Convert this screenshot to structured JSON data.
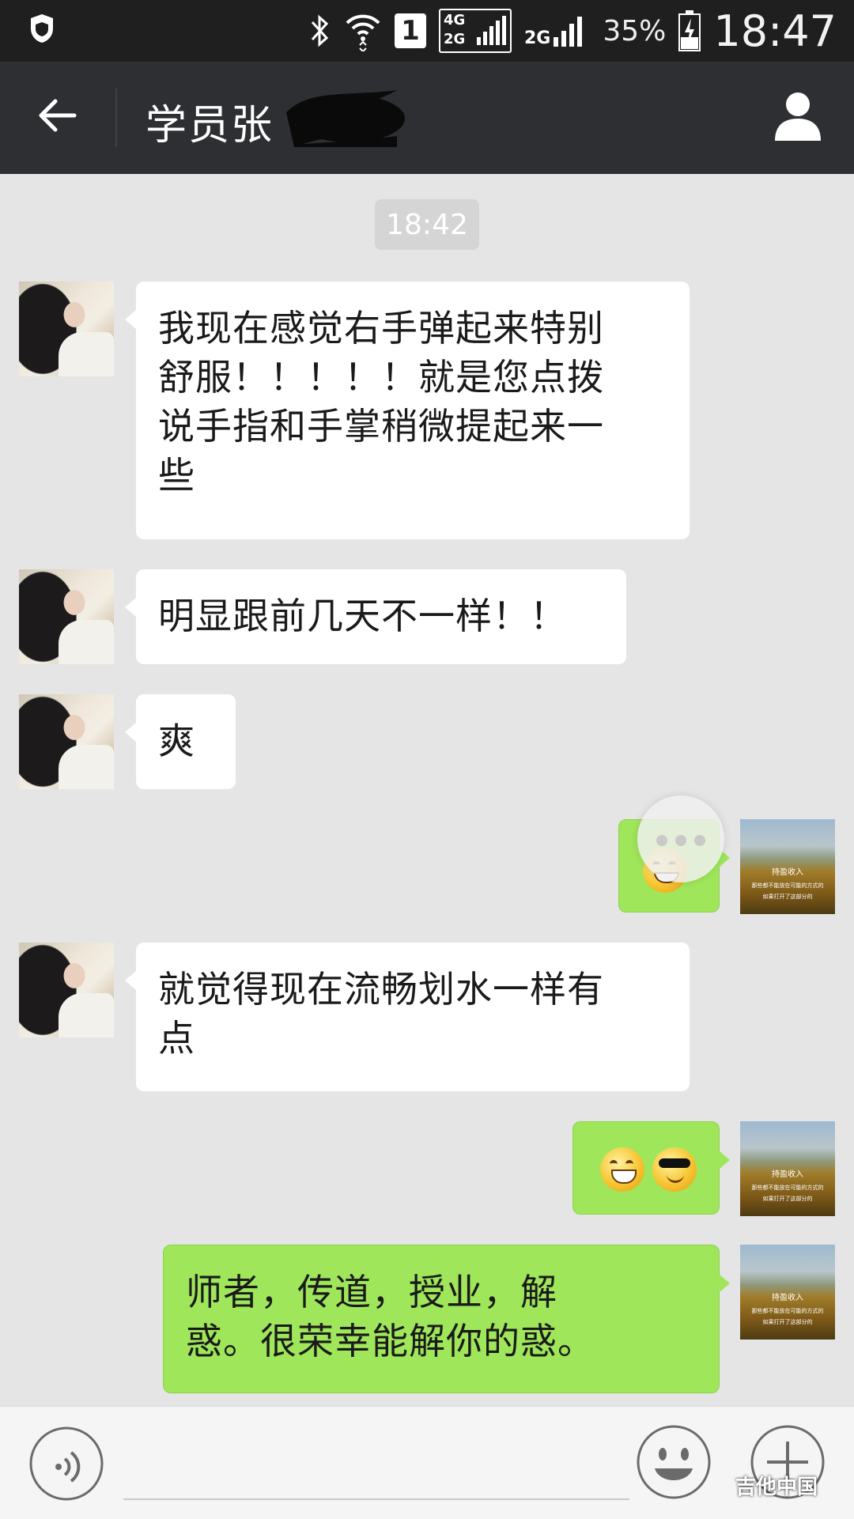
{
  "status_bar": {
    "network_4g": "4G",
    "network_2g_a": "2G",
    "network_2g_b": "2G",
    "sim_slot": "1",
    "battery": "35%",
    "time": "18:47"
  },
  "header": {
    "back_icon": "arrow-left-icon",
    "title": "学员张",
    "profile_icon": "person-icon"
  },
  "timestamp": "18:42",
  "messages": [
    {
      "from": "contact",
      "text_lines": [
        "我现在感觉右手弹起来特别",
        "舒服！！！！！就是您点拨",
        "说手指和手掌稍微提起来一",
        "些"
      ]
    },
    {
      "from": "contact",
      "text_lines": [
        "明显跟前几天不一样！！"
      ]
    },
    {
      "from": "contact",
      "text_lines": [
        "爽"
      ]
    },
    {
      "from": "me",
      "emoji": [
        "hugging-face-emoji"
      ]
    },
    {
      "from": "contact",
      "text_lines": [
        "就觉得现在流畅划水一样有",
        "点"
      ]
    },
    {
      "from": "me",
      "emoji": [
        "grinning-face-emoji",
        "sunglasses-face-emoji"
      ]
    },
    {
      "from": "me",
      "text_lines": [
        "师者，传道，授业，解",
        "惑。很荣幸能解你的惑。"
      ]
    }
  ],
  "my_avatar_caption": [
    "持盈收入",
    "那些都不能放在可能的方式的",
    "如果打开了这部分的"
  ],
  "input_bar": {
    "voice_icon": "voice-icon",
    "emoji_icon": "smiley-icon",
    "plus_icon": "plus-icon"
  },
  "watermark": "吉他中国"
}
